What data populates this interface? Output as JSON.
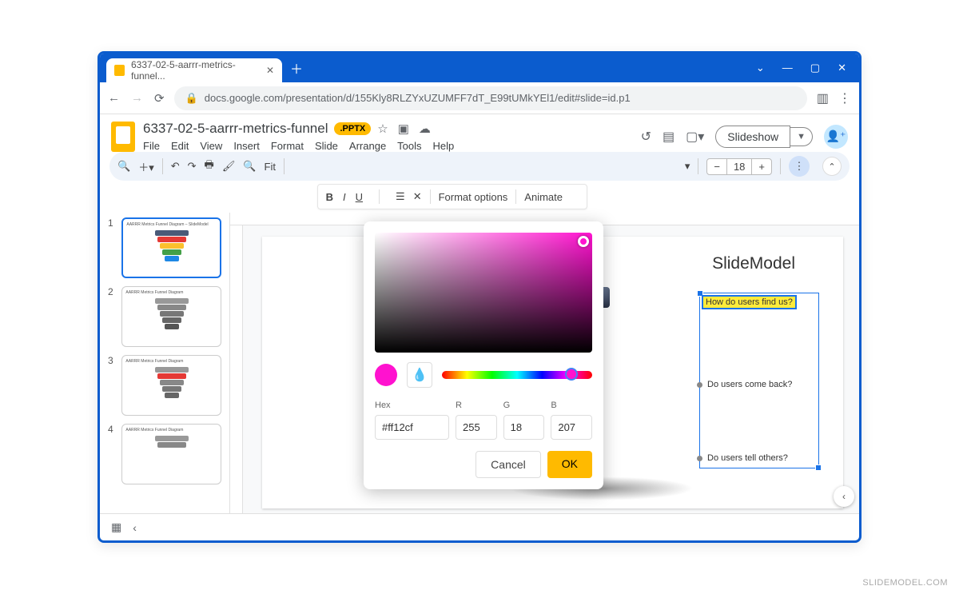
{
  "browser": {
    "tab_title": "6337-02-5-aarrr-metrics-funnel...",
    "url": "docs.google.com/presentation/d/155Kly8RLZYxUZUMFF7dT_E99tUMkYEl1/edit#slide=id.p1"
  },
  "doc": {
    "title": "6337-02-5-aarrr-metrics-funnel",
    "badge": ".PPTX",
    "menus": [
      "File",
      "Edit",
      "View",
      "Insert",
      "Format",
      "Slide",
      "Arrange",
      "Tools",
      "Help"
    ],
    "slideshow": "Slideshow"
  },
  "toolbar": {
    "zoom": "Fit",
    "font_size": "18",
    "format_options": "Format options",
    "animate": "Animate"
  },
  "thumbs": {
    "title": "AARRR Metrics Funnel Diagram – SlideModel",
    "subtitle": "AARRR Metrics Funnel Diagram"
  },
  "slide": {
    "title_fragment": "SlideModel",
    "labels": [
      "How do users find us?",
      "Do users come back?",
      "Do users tell others?"
    ]
  },
  "picker": {
    "hex_label": "Hex",
    "r_label": "R",
    "g_label": "G",
    "b_label": "B",
    "hex": "#ff12cf",
    "r": "255",
    "g": "18",
    "b": "207",
    "cancel": "Cancel",
    "ok": "OK"
  },
  "watermark": "SLIDEMODEL.COM"
}
